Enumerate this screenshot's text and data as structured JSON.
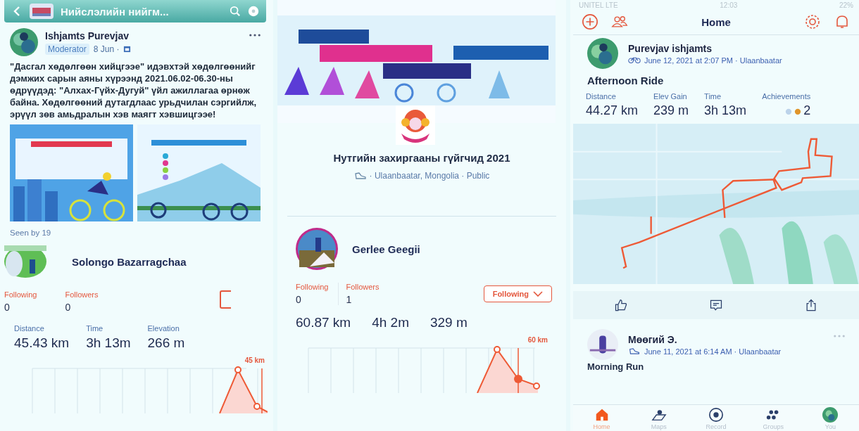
{
  "group_feed": {
    "header": {
      "title": "Нийслэлийн нийгм..."
    },
    "post": {
      "author": "Ishjamts Purevjav",
      "role": "Moderator",
      "date": "8 Jun ·",
      "text": "\"Дасгал хөдөлгөөн хийцгээе\" идэвхтэй хөдөлгөөнийг дэмжих сарын аяны хүрээнд 2021.06.02-06.30-ны өдрүүдэд: \"Алхах-Гүйх-Дугуй\" үйл ажиллагаа өрнөж байна. Хөдөлгөөний дутагдлаас урьдчилан сэргийлж, эрүүл зөв амьдралын хэв маягт хэвшицгээе!",
      "seen": "Seen by 19"
    },
    "athlete": {
      "name": "Solongo Bazarragchaa",
      "following_label": "Following",
      "following": "0",
      "followers_label": "Followers",
      "followers": "0",
      "stats": [
        {
          "label": "Distance",
          "value": "45.43 km"
        },
        {
          "label": "Time",
          "value": "3h 13m"
        },
        {
          "label": "Elevation",
          "value": "266 m"
        }
      ],
      "chart_label": "45 km"
    }
  },
  "club": {
    "name": "Нутгийн захиргааны гүйгчид 2021",
    "meta": "· Ulaanbaatar, Mongolia · Public",
    "athlete": {
      "name": "Gerlee Geegii",
      "following_label": "Following",
      "following": "0",
      "followers_label": "Followers",
      "followers": "1",
      "follow_button": "Following",
      "stats": [
        {
          "value": "60.87 km"
        },
        {
          "value": "4h  2m"
        },
        {
          "value": "329 m"
        }
      ],
      "chart_label": "60 km"
    }
  },
  "home": {
    "status_bar": {
      "carrier": "UNITEL  LTE",
      "time": "12:03",
      "battery": "22%"
    },
    "title": "Home",
    "activity": {
      "author": "Purevjav ishjamts",
      "meta": "June 12, 2021 at 2:07 PM · Ulaanbaatar",
      "title": "Afternoon Ride",
      "stats": [
        {
          "label": "Distance",
          "value": "44.27 km"
        },
        {
          "label": "Elev Gain",
          "value": "239 m"
        },
        {
          "label": "Time",
          "value": "3h 13m"
        }
      ],
      "achievements_label": "Achievements",
      "achievements": "2"
    },
    "next": {
      "author": "Мөөгий Э.",
      "meta": "June 11, 2021 at 6:14 AM · Ulaanbaatar",
      "title": "Morning Run"
    },
    "tab_bar": [
      {
        "label": "Home",
        "selected": true
      },
      {
        "label": "Maps",
        "selected": false
      },
      {
        "label": "Record",
        "selected": false
      },
      {
        "label": "Groups",
        "selected": false
      },
      {
        "label": "You",
        "selected": false
      }
    ]
  }
}
